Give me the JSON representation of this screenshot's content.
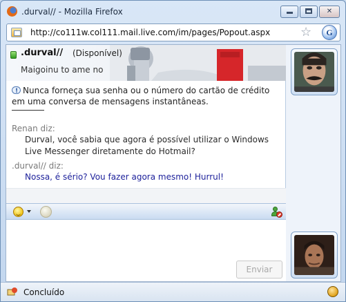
{
  "window": {
    "title": ".durval// - Mozilla Firefox",
    "browser_icon": "firefox-logo"
  },
  "address_bar": {
    "url": "http://co111w.col111.mail.live.com/im/pages/Popout.aspx",
    "bookmark_icon": "star-icon",
    "search_engine_icon": "search-engine-icon"
  },
  "chat": {
    "contact": {
      "name": ".durval//",
      "status": "(Disponível)",
      "personal_message": "Maigoinu to ame no",
      "status_color": "#3aa52a"
    },
    "security_warning": "Nunca forneça sua senha ou o número do cartão de crédito em uma conversa de mensagens instantâneas.",
    "messages": [
      {
        "sender": "Renan diz:",
        "text": "Durval, você sabia que agora é possível utilizar o Windows Live Messenger diretamente do Hotmail?",
        "direction": "incoming"
      },
      {
        "sender": ".durval// diz:",
        "text": "Nossa, é sério? Vou fazer agora mesmo! Hurrul!",
        "direction": "outgoing"
      }
    ],
    "toolbar": {
      "emoticon_icon": "emoticon-icon",
      "wink_icon": "wink-icon",
      "block_icon": "block-user-icon"
    },
    "compose": {
      "send_label": "Enviar"
    }
  },
  "statusbar": {
    "text": "Concluído"
  },
  "colors": {
    "outgoing_text": "#1b1f9a",
    "sender_text": "#7a7a7a",
    "toolbar_blue": "#c9dbf1"
  }
}
